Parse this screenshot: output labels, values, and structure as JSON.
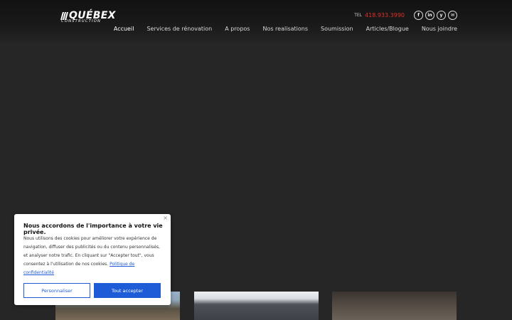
{
  "brand": {
    "name": "QUÉBEX",
    "sub": "CONSTRUCTION"
  },
  "contact": {
    "tel_label": "TEL",
    "tel_number": "418.933.3990"
  },
  "social": [
    {
      "icon": "facebook-icon",
      "glyph": "f"
    },
    {
      "icon": "linkedin-icon",
      "glyph": "in"
    },
    {
      "icon": "yelp-icon",
      "glyph": "y"
    },
    {
      "icon": "email-icon",
      "glyph": "✉"
    }
  ],
  "nav": [
    {
      "label": "Accueil",
      "active": true
    },
    {
      "label": "Services de rénovation"
    },
    {
      "label": "A propos"
    },
    {
      "label": "Nos realisations"
    },
    {
      "label": "Soumission"
    },
    {
      "label": "Articles/Blogue"
    },
    {
      "label": "Nous joindre"
    }
  ],
  "cookie": {
    "title": "Nous accordons de l'importance à votre vie privée.",
    "text": "Nous utilisons des cookies pour améliorer votre expérience de navigation, diffuser des publicités ou du contenu personnalisés, et analyser notre trafic. En cliquant sur \"Accepter tout\", vous consentez à l'utilisation de nos cookies.",
    "link": "Politique de confidentialité",
    "btn_customize": "Personnaliser",
    "btn_accept": "Tout accepter",
    "close": "×"
  },
  "colors": {
    "accent": "#1e5bd6",
    "phone": "#e0312a",
    "background": "#262626"
  }
}
